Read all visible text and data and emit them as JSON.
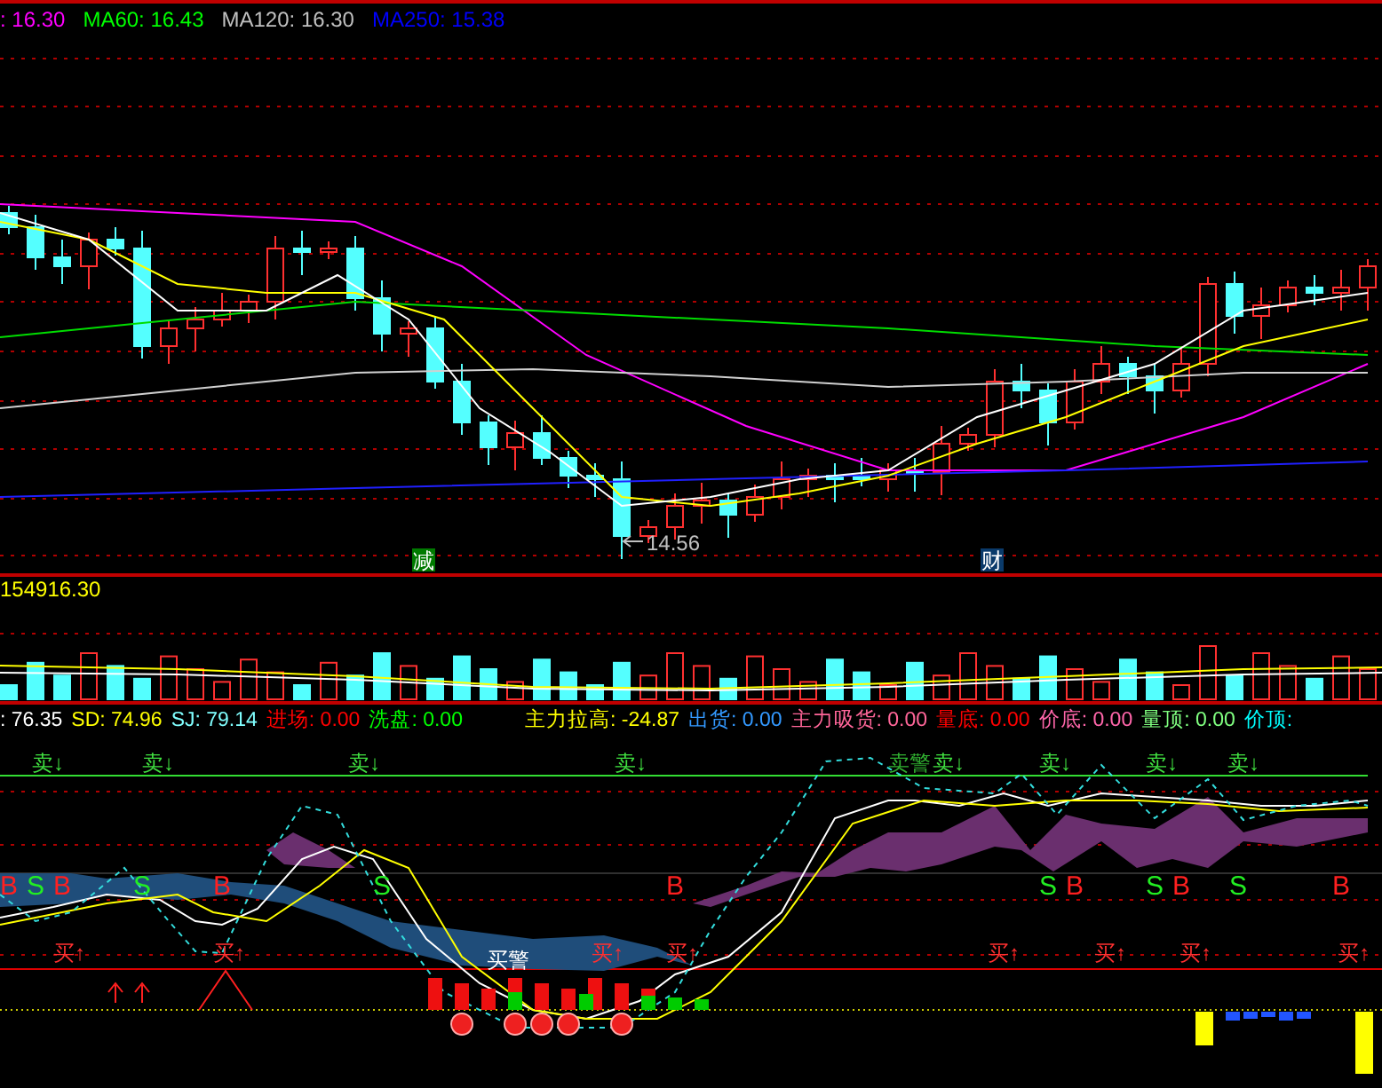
{
  "price_panel": {
    "legend": [
      {
        "label": ": 16.30",
        "color": "#ff00ff"
      },
      {
        "label": "MA60: 16.43",
        "color": "#00ff00"
      },
      {
        "label": "MA120: 16.30",
        "color": "#c0c0c0"
      },
      {
        "label": "MA250: 15.38",
        "color": "#0000ff"
      }
    ],
    "low_marker": "14.56",
    "badges": [
      {
        "text": "减",
        "color": "#007a00"
      },
      {
        "text": "财",
        "color": "#0a3a6a"
      }
    ]
  },
  "volume_panel": {
    "reading": "154916.30"
  },
  "indicator_panel": {
    "legend": [
      {
        "label": ": 76.35",
        "color": "#ffffff"
      },
      {
        "label": "SD: 74.96",
        "color": "#ffff00"
      },
      {
        "label": "SJ: 79.14",
        "color": "#80ffff"
      },
      {
        "label": "进场: 0.00",
        "color": "#ff0000"
      },
      {
        "label": "洗盘: 0.00",
        "color": "#00ff00"
      },
      {
        "label": "主力拉高: -24.87",
        "color": "#ffff00"
      },
      {
        "label": "出货: 0.00",
        "color": "#3399ff"
      },
      {
        "label": "主力吸货: 0.00",
        "color": "#ff6699"
      },
      {
        "label": "量底: 0.00",
        "color": "#ff0000"
      },
      {
        "label": "价底: 0.00",
        "color": "#ff66aa"
      },
      {
        "label": "量顶: 0.00",
        "color": "#80ff80"
      },
      {
        "label": "价顶:",
        "color": "#00ffff"
      }
    ],
    "sell_signals": [
      {
        "text": "卖↓",
        "kind": "sell"
      },
      {
        "text": "卖↓",
        "kind": "sell"
      },
      {
        "text": "卖↓",
        "kind": "sell"
      },
      {
        "text": "卖↓",
        "kind": "sell"
      },
      {
        "text": "卖警",
        "kind": "warning"
      },
      {
        "text": "卖↓",
        "kind": "sell"
      },
      {
        "text": "卖↓",
        "kind": "sell"
      },
      {
        "text": "卖↓",
        "kind": "sell"
      },
      {
        "text": "卖↓",
        "kind": "sell"
      }
    ],
    "sb_marks": [
      {
        "text": "B",
        "kind": "buy"
      },
      {
        "text": "S",
        "kind": "sell"
      },
      {
        "text": "B",
        "kind": "buy"
      },
      {
        "text": "S",
        "kind": "sell"
      },
      {
        "text": "B",
        "kind": "buy"
      },
      {
        "text": "S",
        "kind": "sell"
      },
      {
        "text": "B",
        "kind": "buy"
      },
      {
        "text": "S",
        "kind": "sell"
      },
      {
        "text": "B",
        "kind": "buy"
      },
      {
        "text": "S",
        "kind": "sell"
      },
      {
        "text": "B",
        "kind": "buy"
      },
      {
        "text": "S",
        "kind": "sell"
      },
      {
        "text": "B",
        "kind": "buy"
      }
    ],
    "buy_signals": [
      "买↑",
      "买↑",
      "买↑",
      "买↑",
      "买↑",
      "买↑",
      "买↑",
      "买↑"
    ],
    "buy_warning": "买警"
  }
}
